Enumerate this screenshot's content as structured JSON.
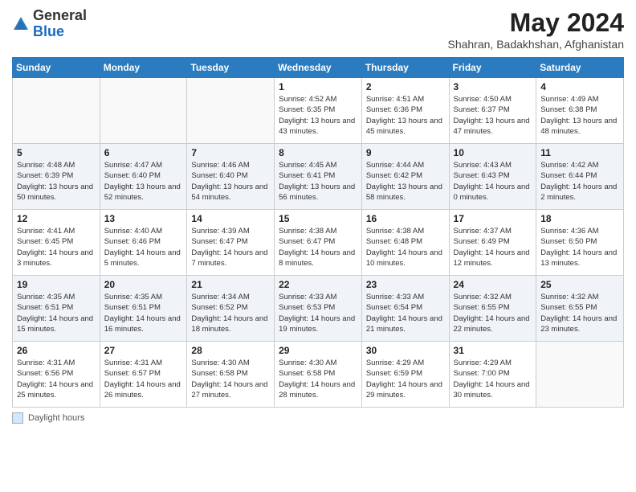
{
  "header": {
    "logo_general": "General",
    "logo_blue": "Blue",
    "month_year": "May 2024",
    "location": "Shahran, Badakhshan, Afghanistan"
  },
  "days_of_week": [
    "Sunday",
    "Monday",
    "Tuesday",
    "Wednesday",
    "Thursday",
    "Friday",
    "Saturday"
  ],
  "footer": {
    "legend_label": "Daylight hours"
  },
  "weeks": [
    {
      "days": [
        {
          "num": "",
          "info": ""
        },
        {
          "num": "",
          "info": ""
        },
        {
          "num": "",
          "info": ""
        },
        {
          "num": "1",
          "info": "Sunrise: 4:52 AM\nSunset: 6:35 PM\nDaylight: 13 hours\nand 43 minutes."
        },
        {
          "num": "2",
          "info": "Sunrise: 4:51 AM\nSunset: 6:36 PM\nDaylight: 13 hours\nand 45 minutes."
        },
        {
          "num": "3",
          "info": "Sunrise: 4:50 AM\nSunset: 6:37 PM\nDaylight: 13 hours\nand 47 minutes."
        },
        {
          "num": "4",
          "info": "Sunrise: 4:49 AM\nSunset: 6:38 PM\nDaylight: 13 hours\nand 48 minutes."
        }
      ]
    },
    {
      "days": [
        {
          "num": "5",
          "info": "Sunrise: 4:48 AM\nSunset: 6:39 PM\nDaylight: 13 hours\nand 50 minutes."
        },
        {
          "num": "6",
          "info": "Sunrise: 4:47 AM\nSunset: 6:40 PM\nDaylight: 13 hours\nand 52 minutes."
        },
        {
          "num": "7",
          "info": "Sunrise: 4:46 AM\nSunset: 6:40 PM\nDaylight: 13 hours\nand 54 minutes."
        },
        {
          "num": "8",
          "info": "Sunrise: 4:45 AM\nSunset: 6:41 PM\nDaylight: 13 hours\nand 56 minutes."
        },
        {
          "num": "9",
          "info": "Sunrise: 4:44 AM\nSunset: 6:42 PM\nDaylight: 13 hours\nand 58 minutes."
        },
        {
          "num": "10",
          "info": "Sunrise: 4:43 AM\nSunset: 6:43 PM\nDaylight: 14 hours\nand 0 minutes."
        },
        {
          "num": "11",
          "info": "Sunrise: 4:42 AM\nSunset: 6:44 PM\nDaylight: 14 hours\nand 2 minutes."
        }
      ]
    },
    {
      "days": [
        {
          "num": "12",
          "info": "Sunrise: 4:41 AM\nSunset: 6:45 PM\nDaylight: 14 hours\nand 3 minutes."
        },
        {
          "num": "13",
          "info": "Sunrise: 4:40 AM\nSunset: 6:46 PM\nDaylight: 14 hours\nand 5 minutes."
        },
        {
          "num": "14",
          "info": "Sunrise: 4:39 AM\nSunset: 6:47 PM\nDaylight: 14 hours\nand 7 minutes."
        },
        {
          "num": "15",
          "info": "Sunrise: 4:38 AM\nSunset: 6:47 PM\nDaylight: 14 hours\nand 8 minutes."
        },
        {
          "num": "16",
          "info": "Sunrise: 4:38 AM\nSunset: 6:48 PM\nDaylight: 14 hours\nand 10 minutes."
        },
        {
          "num": "17",
          "info": "Sunrise: 4:37 AM\nSunset: 6:49 PM\nDaylight: 14 hours\nand 12 minutes."
        },
        {
          "num": "18",
          "info": "Sunrise: 4:36 AM\nSunset: 6:50 PM\nDaylight: 14 hours\nand 13 minutes."
        }
      ]
    },
    {
      "days": [
        {
          "num": "19",
          "info": "Sunrise: 4:35 AM\nSunset: 6:51 PM\nDaylight: 14 hours\nand 15 minutes."
        },
        {
          "num": "20",
          "info": "Sunrise: 4:35 AM\nSunset: 6:51 PM\nDaylight: 14 hours\nand 16 minutes."
        },
        {
          "num": "21",
          "info": "Sunrise: 4:34 AM\nSunset: 6:52 PM\nDaylight: 14 hours\nand 18 minutes."
        },
        {
          "num": "22",
          "info": "Sunrise: 4:33 AM\nSunset: 6:53 PM\nDaylight: 14 hours\nand 19 minutes."
        },
        {
          "num": "23",
          "info": "Sunrise: 4:33 AM\nSunset: 6:54 PM\nDaylight: 14 hours\nand 21 minutes."
        },
        {
          "num": "24",
          "info": "Sunrise: 4:32 AM\nSunset: 6:55 PM\nDaylight: 14 hours\nand 22 minutes."
        },
        {
          "num": "25",
          "info": "Sunrise: 4:32 AM\nSunset: 6:55 PM\nDaylight: 14 hours\nand 23 minutes."
        }
      ]
    },
    {
      "days": [
        {
          "num": "26",
          "info": "Sunrise: 4:31 AM\nSunset: 6:56 PM\nDaylight: 14 hours\nand 25 minutes."
        },
        {
          "num": "27",
          "info": "Sunrise: 4:31 AM\nSunset: 6:57 PM\nDaylight: 14 hours\nand 26 minutes."
        },
        {
          "num": "28",
          "info": "Sunrise: 4:30 AM\nSunset: 6:58 PM\nDaylight: 14 hours\nand 27 minutes."
        },
        {
          "num": "29",
          "info": "Sunrise: 4:30 AM\nSunset: 6:58 PM\nDaylight: 14 hours\nand 28 minutes."
        },
        {
          "num": "30",
          "info": "Sunrise: 4:29 AM\nSunset: 6:59 PM\nDaylight: 14 hours\nand 29 minutes."
        },
        {
          "num": "31",
          "info": "Sunrise: 4:29 AM\nSunset: 7:00 PM\nDaylight: 14 hours\nand 30 minutes."
        },
        {
          "num": "",
          "info": ""
        }
      ]
    }
  ]
}
